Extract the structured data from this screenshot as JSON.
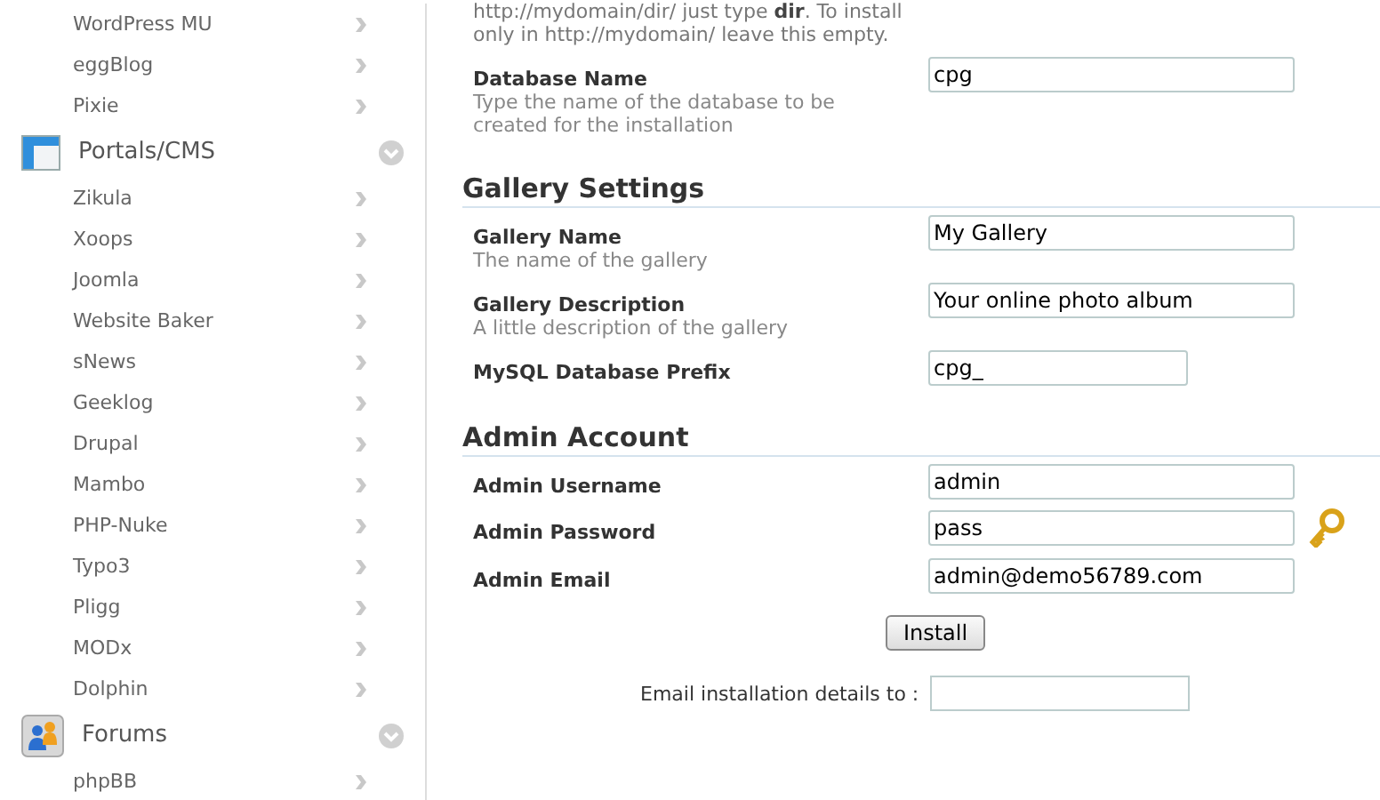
{
  "sidebar": {
    "items": [
      {
        "label": "WordPress MU"
      },
      {
        "label": "eggBlog"
      },
      {
        "label": "Pixie"
      }
    ],
    "sections": [
      {
        "title": "Portals/CMS",
        "kind": "cms",
        "expanded": true,
        "items": [
          {
            "label": "Zikula"
          },
          {
            "label": "Xoops"
          },
          {
            "label": "Joomla"
          },
          {
            "label": "Website Baker"
          },
          {
            "label": "sNews"
          },
          {
            "label": "Geeklog"
          },
          {
            "label": "Drupal"
          },
          {
            "label": "Mambo"
          },
          {
            "label": "PHP-Nuke"
          },
          {
            "label": "Typo3"
          },
          {
            "label": "Pligg"
          },
          {
            "label": "MODx"
          },
          {
            "label": "Dolphin"
          }
        ]
      },
      {
        "title": "Forums",
        "kind": "forums",
        "expanded": true,
        "items": [
          {
            "label": "phpBB"
          }
        ]
      }
    ]
  },
  "form": {
    "note": "http://mydomain/dir/ just type **dir**. To install only in http://mydomain/ leave this empty.",
    "sections": [
      {
        "fields": [
          {
            "label": "Database Name",
            "description": "Type the name of the database to be created for the installation",
            "value": "cpg",
            "kind": "text"
          }
        ]
      },
      {
        "heading": "Gallery Settings",
        "fields": [
          {
            "label": "Gallery Name",
            "description": "The name of the gallery",
            "value": "My Gallery",
            "kind": "text"
          },
          {
            "label": "Gallery Description",
            "description": "A little description of the gallery",
            "value": "Your online photo album",
            "kind": "text"
          },
          {
            "label": "MySQL Database Prefix",
            "value": "cpg_",
            "kind": "short"
          }
        ]
      },
      {
        "heading": "Admin Account",
        "fields": [
          {
            "label": "Admin Username",
            "value": "admin",
            "kind": "text"
          },
          {
            "label": "Admin Password",
            "value": "pass",
            "kind": "key"
          },
          {
            "label": "Admin Email",
            "value": "admin@demo56789.com",
            "kind": "text"
          }
        ]
      }
    ],
    "submit": "Install",
    "email_details": {
      "label": "Email installation details to :"
    }
  }
}
